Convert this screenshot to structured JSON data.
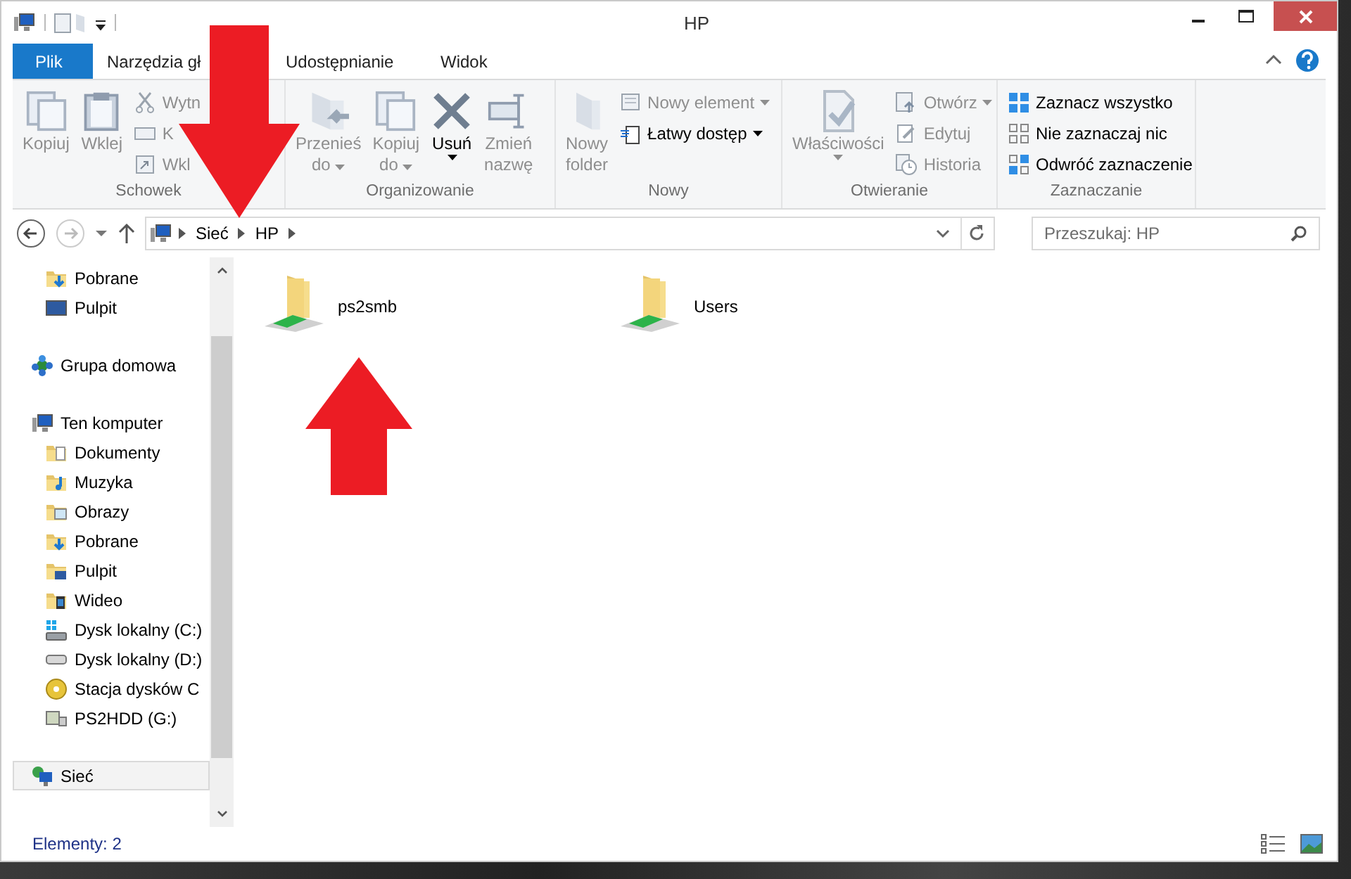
{
  "window": {
    "title": "HP"
  },
  "ribbon_tabs": [
    {
      "label": "Plik",
      "kind": "file"
    },
    {
      "label": "Narzędzia gł",
      "kind": "tab"
    },
    {
      "label": "Udostępnianie",
      "kind": "tab"
    },
    {
      "label": "Widok",
      "kind": "tab"
    }
  ],
  "ribbon_groups": [
    {
      "label": "Schowek",
      "buttons": [
        {
          "kind": "large",
          "lines": [
            "Kopiuj"
          ],
          "disabled": true,
          "menu": false
        },
        {
          "kind": "large",
          "lines": [
            "Wklej"
          ],
          "disabled": true,
          "menu": false
        },
        {
          "kind": "stack",
          "items": [
            {
              "label": "Wytn",
              "disabled": true,
              "menu": false
            },
            {
              "label": "K",
              "disabled": true,
              "menu": false
            },
            {
              "label": "Wkl",
              "disabled": true,
              "menu": false
            }
          ]
        }
      ]
    },
    {
      "label": "Organizowanie",
      "buttons": [
        {
          "kind": "large",
          "lines": [
            "Przenieś",
            "do"
          ],
          "disabled": true,
          "menu": true
        },
        {
          "kind": "large",
          "lines": [
            "Kopiuj",
            "do"
          ],
          "disabled": true,
          "menu": true
        },
        {
          "kind": "large",
          "lines": [
            "Usuń"
          ],
          "disabled": false,
          "menu": true
        },
        {
          "kind": "large",
          "lines": [
            "Zmień",
            "nazwę"
          ],
          "disabled": true,
          "menu": false
        }
      ]
    },
    {
      "label": "Nowy",
      "buttons": [
        {
          "kind": "large",
          "lines": [
            "Nowy",
            "folder"
          ],
          "disabled": true,
          "menu": false
        },
        {
          "kind": "stack",
          "items": [
            {
              "label": "Nowy element",
              "disabled": true,
              "menu": true
            },
            {
              "label": "Łatwy dostęp",
              "disabled": false,
              "menu": true
            }
          ]
        }
      ]
    },
    {
      "label": "Otwieranie",
      "buttons": [
        {
          "kind": "large",
          "lines": [
            "Właściwości"
          ],
          "disabled": true,
          "menu": true
        },
        {
          "kind": "stack",
          "items": [
            {
              "label": "Otwórz",
              "disabled": true,
              "menu": true
            },
            {
              "label": "Edytuj",
              "disabled": true,
              "menu": false
            },
            {
              "label": "Historia",
              "disabled": true,
              "menu": false
            }
          ]
        }
      ]
    },
    {
      "label": "Zaznaczanie",
      "buttons": [
        {
          "kind": "stack",
          "items": [
            {
              "label": "Zaznacz wszystko",
              "disabled": false,
              "menu": false
            },
            {
              "label": "Nie zaznaczaj nic",
              "disabled": false,
              "menu": false
            },
            {
              "label": "Odwróć zaznaczenie",
              "disabled": false,
              "menu": false
            }
          ]
        }
      ]
    }
  ],
  "address": {
    "breadcrumbs": [
      "Sieć",
      "HP"
    ]
  },
  "search": {
    "placeholder": "Przeszukaj: HP"
  },
  "nav": {
    "continued": [
      {
        "label": "Pobrane",
        "kind": "download",
        "selected": false
      },
      {
        "label": "Pulpit",
        "kind": "desktop",
        "selected": false
      }
    ],
    "items": [
      {
        "label": "Grupa domowa",
        "kind": "homegroup",
        "selected": false
      },
      {
        "label": "Ten komputer",
        "kind": "computer",
        "selected": false,
        "children": [
          {
            "label": "Dokumenty",
            "kind": "documents",
            "selected": false
          },
          {
            "label": "Muzyka",
            "kind": "music",
            "selected": false
          },
          {
            "label": "Obrazy",
            "kind": "pictures",
            "selected": false
          },
          {
            "label": "Pobrane",
            "kind": "download",
            "selected": false
          },
          {
            "label": "Pulpit",
            "kind": "desktopfolder",
            "selected": false
          },
          {
            "label": "Wideo",
            "kind": "videos",
            "selected": false
          },
          {
            "label": "Dysk lokalny (C:)",
            "kind": "windrive",
            "selected": false
          },
          {
            "label": "Dysk lokalny (D:)",
            "kind": "drive",
            "selected": false
          },
          {
            "label": "Stacja dysków C",
            "kind": "cd",
            "selected": false
          },
          {
            "label": "PS2HDD (G:)",
            "kind": "netdrive",
            "selected": false
          }
        ]
      },
      {
        "label": "Sieć",
        "kind": "network",
        "selected": true
      }
    ]
  },
  "items": [
    {
      "name": "ps2smb",
      "selected": false
    },
    {
      "name": "Users",
      "selected": false
    }
  ],
  "status_bar": {
    "count": "Elementy: 2"
  }
}
